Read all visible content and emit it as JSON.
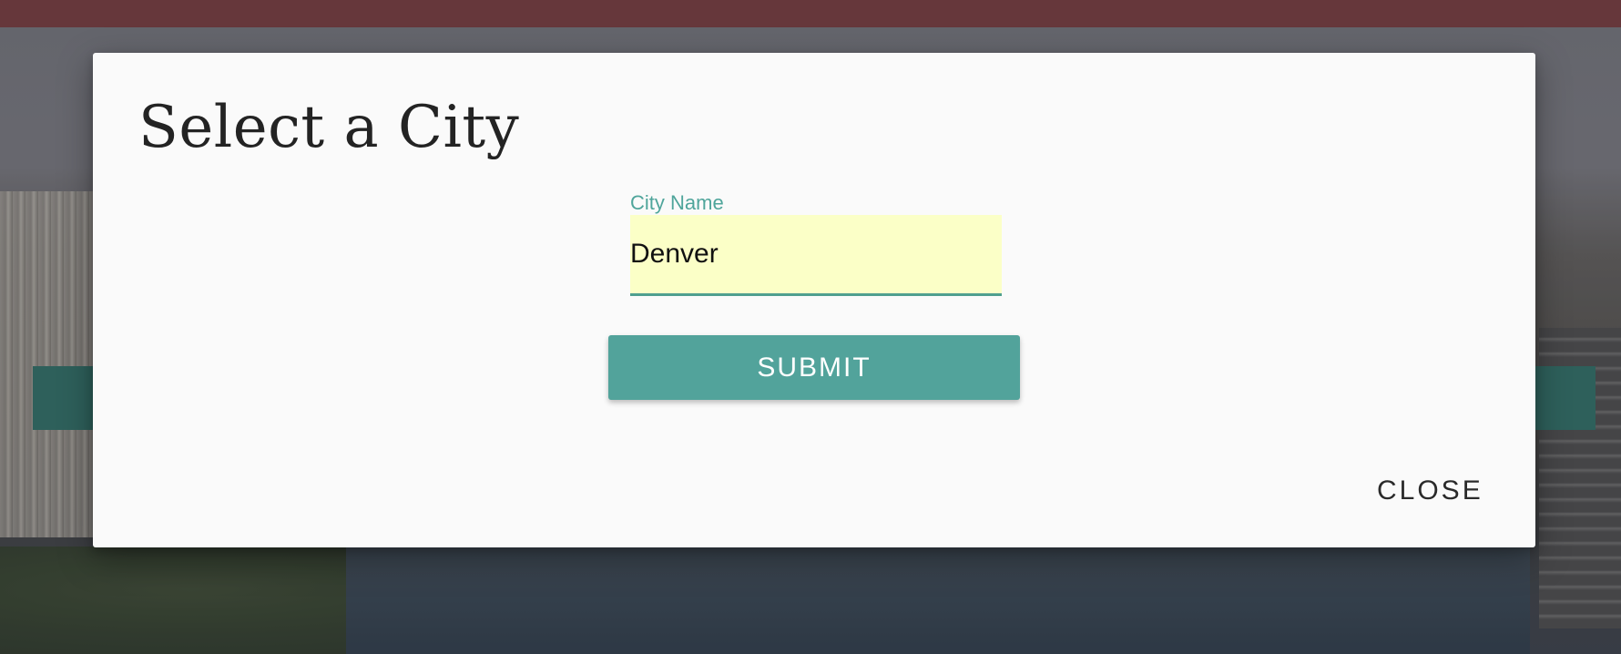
{
  "modal": {
    "title": "Select a City",
    "field": {
      "label": "City Name",
      "value": "Denver",
      "placeholder": ""
    },
    "submit_label": "SUBMIT",
    "close_label": "CLOSE"
  },
  "colors": {
    "top_bar": "#713a3e",
    "accent_teal": "#52a39b",
    "input_background": "#fbffc7",
    "modal_background": "#fafafa"
  }
}
